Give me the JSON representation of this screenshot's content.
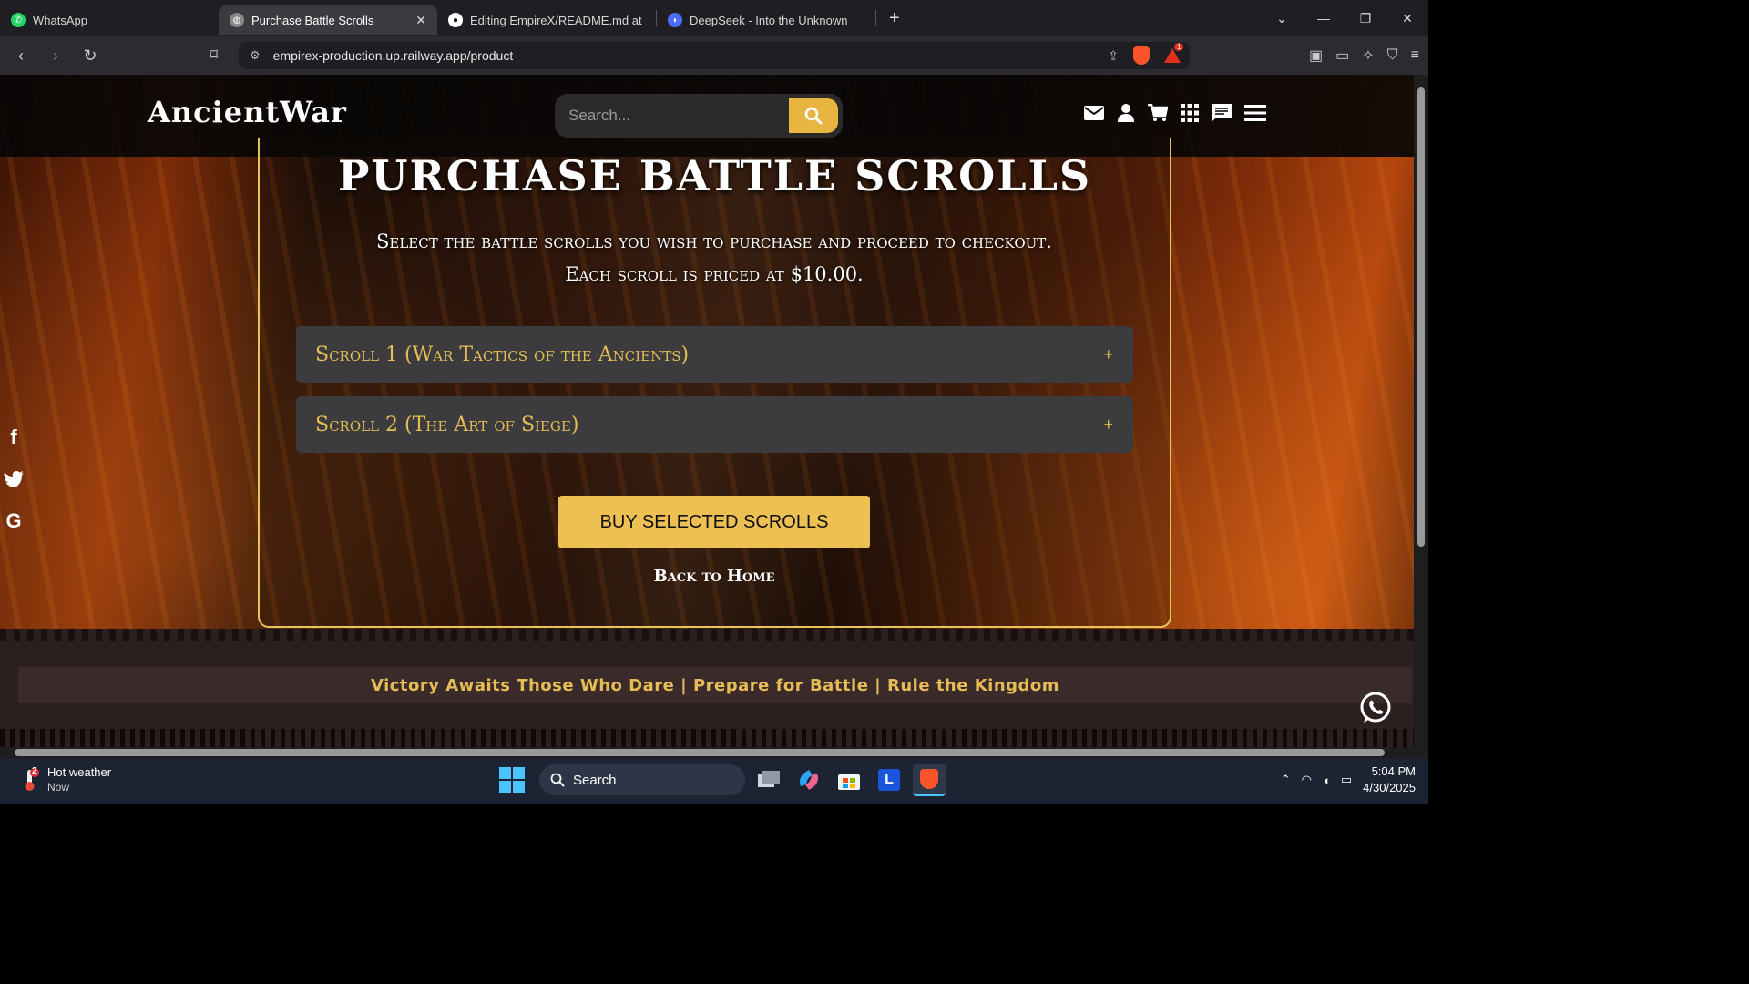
{
  "browser": {
    "tabs": [
      {
        "title": "WhatsApp",
        "icon": "whatsapp-icon",
        "active": false
      },
      {
        "title": "Purchase Battle Scrolls",
        "icon": "globe-icon",
        "active": true
      },
      {
        "title": "Editing EmpireX/README.md at ma",
        "icon": "github-icon",
        "active": false
      },
      {
        "title": "DeepSeek - Into the Unknown",
        "icon": "deepseek-icon",
        "active": false
      }
    ],
    "url": "empirex-production.up.railway.app/product",
    "rewards_badge": "1"
  },
  "site": {
    "logo": "AncientWar",
    "search_placeholder": "Search...",
    "header_icons": [
      "mail-icon",
      "user-icon",
      "cart-icon",
      "grid-icon",
      "chat-icon",
      "menu-icon"
    ],
    "accent_color": "#e8b640"
  },
  "main": {
    "title": "Purchase Battle Scrolls",
    "subtitle_line1": "Select the battle scrolls you wish to purchase and proceed to checkout.",
    "subtitle_line2": "Each scroll is priced at $10.00.",
    "scrolls": [
      {
        "label": "Scroll 1 (War Tactics of the Ancients)",
        "toggle": "+"
      },
      {
        "label": "Scroll 2 (The Art of Siege)",
        "toggle": "+"
      }
    ],
    "buy_button": "BUY SELECTED SCROLLS",
    "back_link": "Back to Home"
  },
  "social": [
    "facebook-icon",
    "twitter-icon",
    "google-icon"
  ],
  "footer": {
    "marquee": "Victory Awaits Those Who Dare | Prepare for Battle | Rule the Kingdom"
  },
  "taskbar": {
    "weather_title": "Hot weather",
    "weather_sub": "Now",
    "weather_badge": "2",
    "search_label": "Search",
    "time": "5:04 PM",
    "date": "4/30/2025"
  }
}
